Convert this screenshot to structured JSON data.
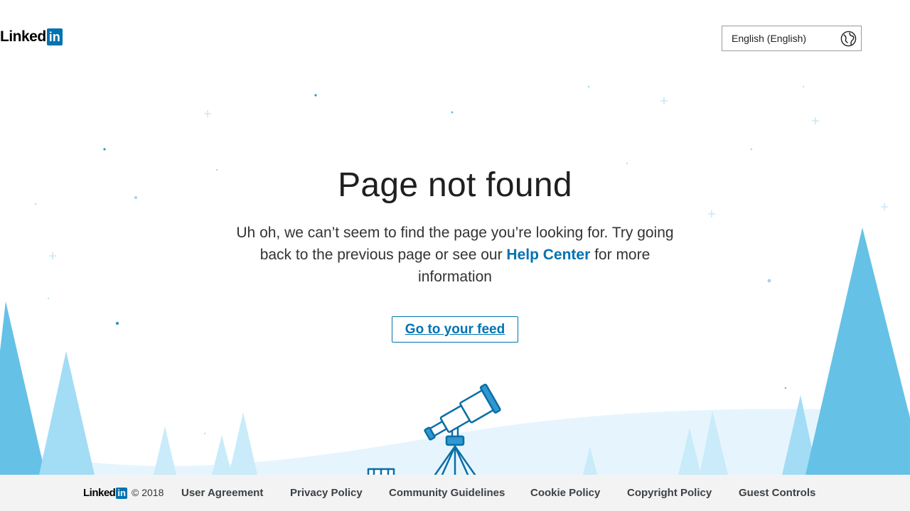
{
  "header": {
    "logo": {
      "text": "Linked",
      "box": "in"
    },
    "language": {
      "selected": "English (English)",
      "icon": "globe-icon"
    }
  },
  "main": {
    "title": "Page not found",
    "message_before": "Uh oh, we can’t seem to find the page you’re looking for. Try going back to the previous page or see our ",
    "help_link": "Help Center",
    "message_after": " for more information",
    "feed_button": "Go to your feed"
  },
  "illustration": {
    "icon": "telescope-icon"
  },
  "footer": {
    "logo": {
      "text": "Linked",
      "box": "in"
    },
    "copyright": "© 2018",
    "links": [
      "User Agreement",
      "Privacy Policy",
      "Community Guidelines",
      "Cookie Policy",
      "Copyright Policy",
      "Guest Controls"
    ]
  },
  "colors": {
    "brand": "#0073b1",
    "tree_dark": "#66c1e6",
    "tree_light": "#a3dcf5",
    "hill": "#e6f5fd",
    "footer_bg": "#f3f3f3"
  }
}
